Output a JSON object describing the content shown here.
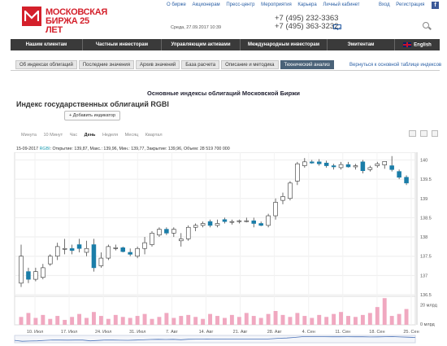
{
  "header": {
    "logo_line1": "МОСКОВСКАЯ",
    "logo_line2": "БИРЖА 25 ЛЕТ",
    "top_links": [
      "О бирже",
      "Акционерам",
      "Пресс-центр",
      "Мероприятия",
      "Карьера",
      "Личный кабинет"
    ],
    "user_links": [
      "Вход",
      "Регистрация"
    ],
    "date_text": "Среда, 27.09.2017 10:39",
    "phone1": "+7 (495) 232-3363",
    "phone2": "+7 (495) 363-3232"
  },
  "nav": {
    "items": [
      "Нашим клиентам",
      "Частным инвесторам",
      "Управляющим активами",
      "Международным инвесторам",
      "Эмитентам"
    ],
    "lang": "English"
  },
  "tabs": {
    "items": [
      "Об индексах облигаций",
      "Последние значения",
      "Архив значений",
      "База расчета",
      "Описание и методика",
      "Технический анализ"
    ],
    "active_index": 5,
    "back_link": "Вернуться к основной таблице индексов"
  },
  "content": {
    "page_title": "Основные индексы облигаций Московской Биржи",
    "index_title": "Индекс государственных облигаций RGBI",
    "add_indicator": "+ Добавить индикатор",
    "periods": [
      "Минута",
      "10 Минут",
      "Час",
      "День",
      "Неделя",
      "Месяц",
      "Квартал"
    ],
    "active_period": "День",
    "ohlc": {
      "date": "15-09-2017",
      "ticker": "RGBI",
      "text": ": Открытие: 139,87, Макс.: 139,96, Мин.: 139,77, Закрытие: 139,96, Объем: 28 519 700 000"
    }
  },
  "colors": {
    "up": "#ffffff",
    "down": "#1a7da8",
    "candle_outline": "#333333",
    "volume": "#f0a8c0",
    "brand": "#d4202b"
  },
  "chart_data": {
    "type": "candlestick",
    "x_tick_labels": [
      "10. Июл",
      "17. Июл",
      "24. Июл",
      "31. Июл",
      "7. Авг",
      "14. Авг",
      "21. Авг",
      "28. Авг",
      "4. Сен",
      "11. Сен",
      "18. Сен",
      "25. Сен"
    ],
    "y_tick_labels": [
      "140",
      "139.5",
      "139",
      "138.5",
      "138",
      "137.5",
      "137",
      "136.5"
    ],
    "ylim": [
      136.5,
      140.2
    ],
    "volume_tick_labels": [
      "20 млрд",
      "0 млрд"
    ],
    "volume_max": 28,
    "candles": [
      {
        "o": 136.8,
        "h": 137.8,
        "l": 136.7,
        "c": 137.5
      },
      {
        "o": 137.1,
        "h": 137.2,
        "l": 136.8,
        "c": 136.9
      },
      {
        "o": 136.9,
        "h": 137.2,
        "l": 136.85,
        "c": 137.1
      },
      {
        "o": 136.95,
        "h": 137.3,
        "l": 136.9,
        "c": 137.2
      },
      {
        "o": 137.3,
        "h": 137.55,
        "l": 137.25,
        "c": 137.5
      },
      {
        "o": 137.5,
        "h": 137.85,
        "l": 137.4,
        "c": 137.75
      },
      {
        "o": 137.7,
        "h": 137.95,
        "l": 137.55,
        "c": 137.7
      },
      {
        "o": 137.7,
        "h": 137.8,
        "l": 137.55,
        "c": 137.65
      },
      {
        "o": 137.8,
        "h": 137.95,
        "l": 137.6,
        "c": 137.7
      },
      {
        "o": 137.6,
        "h": 137.9,
        "l": 137.5,
        "c": 137.7
      },
      {
        "o": 137.8,
        "h": 137.95,
        "l": 137.1,
        "c": 137.2
      },
      {
        "o": 137.25,
        "h": 137.6,
        "l": 137.2,
        "c": 137.45
      },
      {
        "o": 137.45,
        "h": 137.8,
        "l": 137.4,
        "c": 137.75
      },
      {
        "o": 137.7,
        "h": 137.8,
        "l": 137.65,
        "c": 137.72
      },
      {
        "o": 137.72,
        "h": 137.75,
        "l": 137.6,
        "c": 137.62
      },
      {
        "o": 137.6,
        "h": 137.7,
        "l": 137.5,
        "c": 137.55
      },
      {
        "o": 137.5,
        "h": 137.75,
        "l": 137.45,
        "c": 137.7
      },
      {
        "o": 137.7,
        "h": 138.0,
        "l": 137.55,
        "c": 137.85
      },
      {
        "o": 137.8,
        "h": 138.15,
        "l": 137.75,
        "c": 138.1
      },
      {
        "o": 138.05,
        "h": 138.25,
        "l": 138.0,
        "c": 138.2
      },
      {
        "o": 138.2,
        "h": 138.25,
        "l": 138.05,
        "c": 138.1
      },
      {
        "o": 138.1,
        "h": 138.25,
        "l": 138.0,
        "c": 138.2
      },
      {
        "o": 137.9,
        "h": 138.1,
        "l": 137.75,
        "c": 137.95
      },
      {
        "o": 137.95,
        "h": 138.3,
        "l": 137.9,
        "c": 138.25
      },
      {
        "o": 138.25,
        "h": 138.35,
        "l": 138.15,
        "c": 138.3
      },
      {
        "o": 138.3,
        "h": 138.4,
        "l": 138.25,
        "c": 138.35
      },
      {
        "o": 138.4,
        "h": 138.45,
        "l": 138.25,
        "c": 138.3
      },
      {
        "o": 138.3,
        "h": 138.45,
        "l": 138.25,
        "c": 138.35
      },
      {
        "o": 138.45,
        "h": 138.5,
        "l": 138.35,
        "c": 138.4
      },
      {
        "o": 138.38,
        "h": 138.45,
        "l": 138.32,
        "c": 138.4
      },
      {
        "o": 138.4,
        "h": 138.45,
        "l": 138.35,
        "c": 138.42
      },
      {
        "o": 138.4,
        "h": 138.5,
        "l": 138.38,
        "c": 138.42
      },
      {
        "o": 138.42,
        "h": 138.5,
        "l": 138.25,
        "c": 138.35
      },
      {
        "o": 138.35,
        "h": 138.4,
        "l": 138.28,
        "c": 138.3
      },
      {
        "o": 138.3,
        "h": 138.6,
        "l": 138.25,
        "c": 138.55
      },
      {
        "o": 138.55,
        "h": 139.0,
        "l": 138.45,
        "c": 138.9
      },
      {
        "o": 138.95,
        "h": 139.15,
        "l": 138.85,
        "c": 139.05
      },
      {
        "o": 139.0,
        "h": 139.45,
        "l": 138.95,
        "c": 139.4
      },
      {
        "o": 139.45,
        "h": 139.95,
        "l": 139.35,
        "c": 139.9
      },
      {
        "o": 139.85,
        "h": 140.05,
        "l": 139.8,
        "c": 139.95
      },
      {
        "o": 139.95,
        "h": 140.0,
        "l": 139.9,
        "c": 139.92
      },
      {
        "o": 139.95,
        "h": 140.02,
        "l": 139.85,
        "c": 139.9
      },
      {
        "o": 139.92,
        "h": 139.98,
        "l": 139.8,
        "c": 139.85
      },
      {
        "o": 139.85,
        "h": 139.9,
        "l": 139.75,
        "c": 139.82
      },
      {
        "o": 139.8,
        "h": 139.95,
        "l": 139.75,
        "c": 139.88
      },
      {
        "o": 139.88,
        "h": 139.95,
        "l": 139.8,
        "c": 139.82
      },
      {
        "o": 139.82,
        "h": 139.9,
        "l": 139.75,
        "c": 139.85
      },
      {
        "o": 139.95,
        "h": 140.0,
        "l": 139.65,
        "c": 139.72
      },
      {
        "o": 139.75,
        "h": 139.85,
        "l": 139.7,
        "c": 139.8
      },
      {
        "o": 139.85,
        "h": 139.95,
        "l": 139.8,
        "c": 139.9
      },
      {
        "o": 139.87,
        "h": 139.96,
        "l": 139.77,
        "c": 139.96
      },
      {
        "o": 139.85,
        "h": 140.1,
        "l": 139.7,
        "c": 139.75
      },
      {
        "o": 139.7,
        "h": 139.75,
        "l": 139.5,
        "c": 139.55
      },
      {
        "o": 139.55,
        "h": 139.6,
        "l": 139.35,
        "c": 139.4
      }
    ],
    "volumes": [
      8,
      12,
      7,
      10,
      6,
      9,
      5,
      8,
      11,
      7,
      13,
      9,
      6,
      10,
      8,
      7,
      9,
      11,
      6,
      8,
      12,
      7,
      9,
      10,
      8,
      6,
      11,
      9,
      7,
      10,
      8,
      12,
      9,
      7,
      11,
      14,
      10,
      8,
      12,
      9,
      7,
      10,
      8,
      11,
      13,
      9,
      8,
      10,
      12,
      18,
      27,
      9,
      11,
      16
    ]
  }
}
